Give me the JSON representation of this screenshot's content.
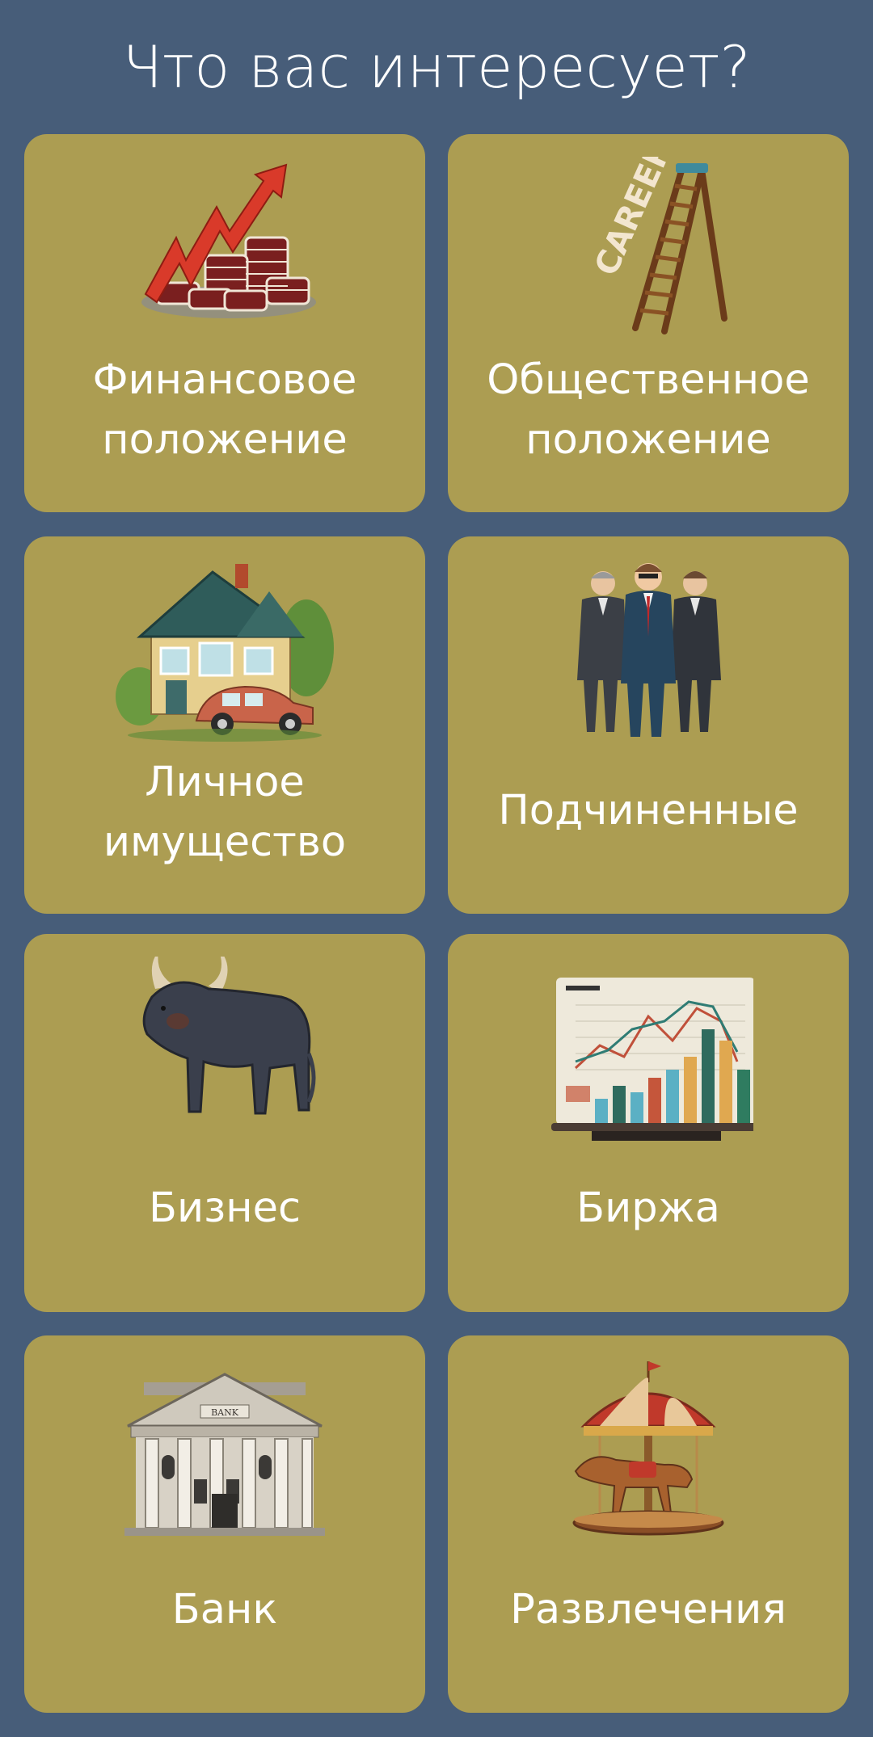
{
  "header": {
    "title": "Что вас интересует?"
  },
  "cards": [
    {
      "line1": "Финансовое",
      "line2": "положение",
      "icon": "finance-growth-icon"
    },
    {
      "line1": "Общественное",
      "line2": "положение",
      "icon": "career-ladder-icon",
      "icon_text": "CAREER"
    },
    {
      "line1": "Личное",
      "line2": "имущество",
      "icon": "house-car-icon"
    },
    {
      "line1": "Подчиненные",
      "icon": "business-team-icon"
    },
    {
      "line1": "Бизнес",
      "icon": "bull-icon"
    },
    {
      "line1": "Биржа",
      "icon": "stock-chart-icon"
    },
    {
      "line1": "Банк",
      "icon": "bank-building-icon",
      "icon_text": "BANK"
    },
    {
      "line1": "Развлечения",
      "icon": "carousel-icon"
    }
  ],
  "colors": {
    "background": "#475d79",
    "card": "#ac9d52",
    "text": "#ffffff"
  }
}
